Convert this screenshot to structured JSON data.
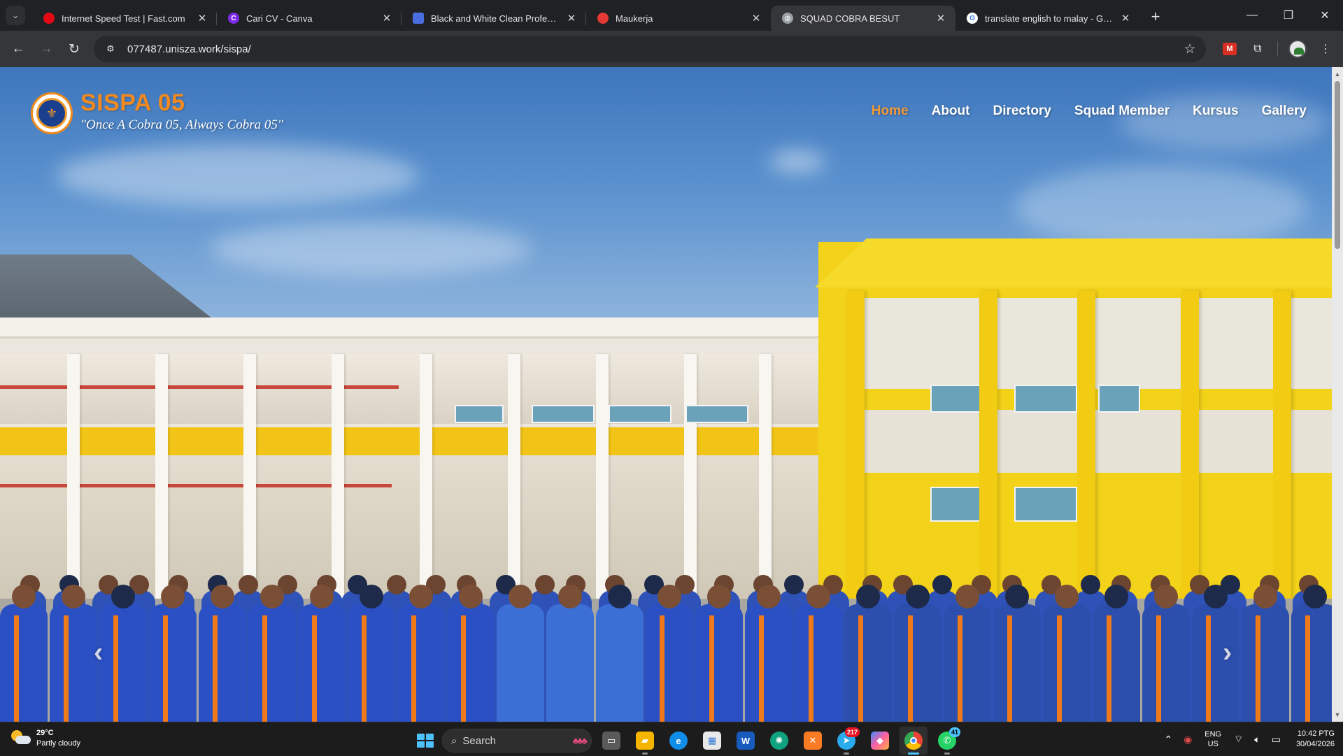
{
  "browser": {
    "tabs": [
      {
        "title": "Internet Speed Test | Fast.com",
        "favicon": "fast-icon",
        "favicon_color": "#e50914",
        "active": false
      },
      {
        "title": "Cari CV - Canva",
        "favicon": "canva-icon",
        "favicon_color": "#7d2ae8",
        "active": false
      },
      {
        "title": "Black and White Clean Professional",
        "favicon": "docs-icon",
        "favicon_color": "#4a6ee0",
        "active": false
      },
      {
        "title": "Maukerja",
        "favicon": "maukerja-icon",
        "favicon_color": "#e53935",
        "active": false
      },
      {
        "title": "SQUAD COBRA BESUT",
        "favicon": "globe-icon",
        "favicon_color": "#9aa0a6",
        "active": true
      },
      {
        "title": "translate english to malay - Google",
        "favicon": "google-icon",
        "favicon_color": "#4285f4",
        "active": false
      }
    ],
    "new_tab": "+",
    "window_controls": {
      "minimize": "—",
      "restore": "❐",
      "close": "✕"
    },
    "url": "077487.unisza.work/sispa/"
  },
  "site": {
    "brand_title": "SISPA 05",
    "tagline": "\"Once A Cobra 05, Always Cobra 05\"",
    "nav": [
      {
        "label": "Home",
        "active": true
      },
      {
        "label": "About",
        "active": false
      },
      {
        "label": "Directory",
        "active": false
      },
      {
        "label": "Squad Member",
        "active": false
      },
      {
        "label": "Kursus",
        "active": false
      },
      {
        "label": "Gallery",
        "active": false
      }
    ],
    "carousel": {
      "prev": "‹",
      "next": "›"
    },
    "accent_color": "#f28a1f"
  },
  "taskbar": {
    "weather": {
      "temp": "29°C",
      "condition": "Partly cloudy"
    },
    "search_placeholder": "Search",
    "apps": [
      {
        "name": "task-view-icon",
        "badge": ""
      },
      {
        "name": "file-explorer-icon",
        "badge": ""
      },
      {
        "name": "edge-icon",
        "badge": ""
      },
      {
        "name": "store-icon",
        "badge": ""
      },
      {
        "name": "word-icon",
        "badge": ""
      },
      {
        "name": "chatgpt-icon",
        "badge": ""
      },
      {
        "name": "xampp-icon",
        "badge": ""
      },
      {
        "name": "telegram-icon",
        "badge": "217"
      },
      {
        "name": "copilot-icon",
        "badge": ""
      },
      {
        "name": "chrome-icon",
        "badge": ""
      },
      {
        "name": "whatsapp-icon",
        "badge": "41"
      }
    ],
    "language": {
      "line1": "ENG",
      "line2": "US"
    },
    "clock": {
      "time": "10:42 PTG",
      "date": "30/04/2026"
    }
  }
}
